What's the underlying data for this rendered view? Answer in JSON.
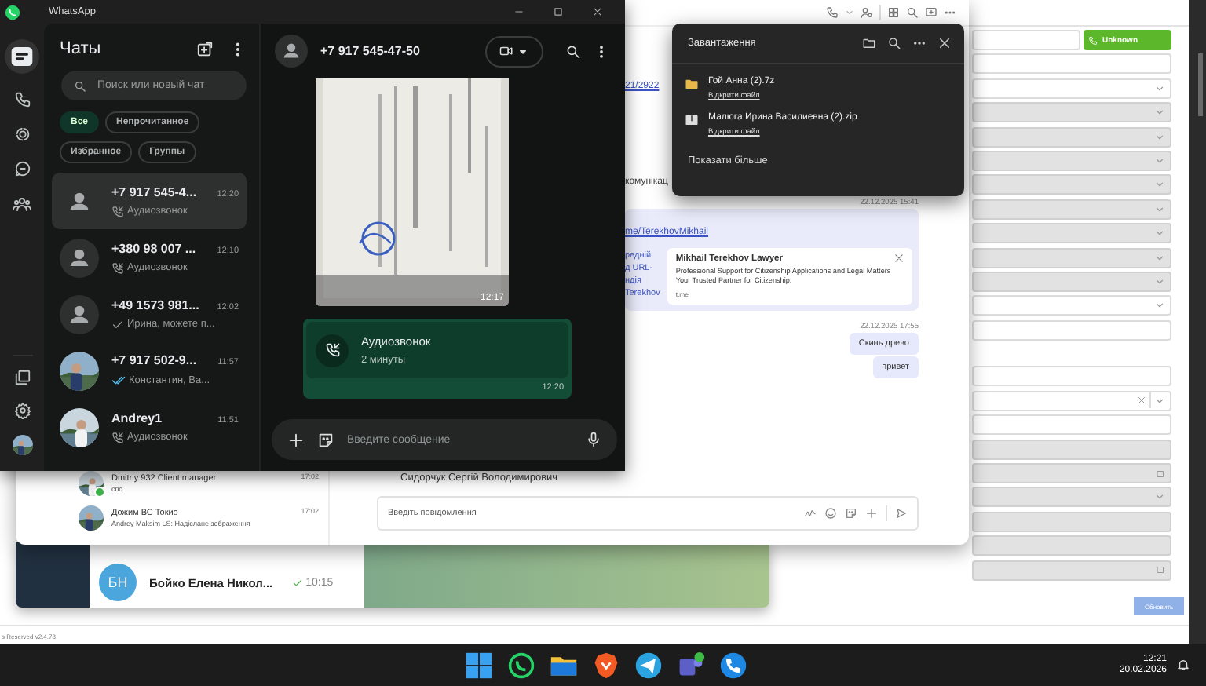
{
  "crm": {
    "call_button": "Unknown",
    "form_fields": [
      {
        "kind": "text",
        "disabled": false
      },
      {
        "kind": "select",
        "disabled": false
      },
      {
        "kind": "select",
        "disabled": true
      },
      {
        "kind": "select",
        "disabled": true
      },
      {
        "kind": "select",
        "disabled": true
      },
      {
        "kind": "select",
        "disabled": true
      },
      {
        "kind": "select",
        "disabled": true
      },
      {
        "kind": "select",
        "disabled": true
      },
      {
        "kind": "select",
        "disabled": true
      },
      {
        "kind": "select",
        "disabled": true
      },
      {
        "kind": "select",
        "disabled": false
      },
      {
        "kind": "text",
        "disabled": false
      }
    ],
    "form_fields_2": [
      {
        "kind": "text",
        "disabled": false
      },
      {
        "kind": "clearable",
        "disabled": false
      },
      {
        "kind": "text",
        "disabled": false
      },
      {
        "kind": "text",
        "disabled": true
      },
      {
        "kind": "date",
        "disabled": true
      },
      {
        "kind": "select",
        "disabled": true
      },
      {
        "kind": "text",
        "disabled": true
      },
      {
        "kind": "text",
        "disabled": true
      },
      {
        "kind": "date",
        "disabled": true
      }
    ],
    "update_button": "Обновить",
    "footer": "s Reserved v2.4.78"
  },
  "telegram": {
    "chat": {
      "initials": "БН",
      "name": "Бойко Елена Никол...",
      "time": "10:15",
      "read": true
    }
  },
  "messenger": {
    "messages": [
      {
        "kind": "link_fragment",
        "text": "21/2922"
      },
      {
        "kind": "text_fragment",
        "text": "комунікац"
      },
      {
        "kind": "date",
        "text": "22.12.2025 15:41"
      },
      {
        "kind": "link_preview",
        "link": "me/TerekhovMikhail",
        "body": [
          "редній",
          "д URL-",
          "ндія",
          "Terekhov"
        ],
        "title": "Mikhail Terekhov Lawyer",
        "description": "Professional Support for Citizenship Applications and Legal Matters Your Trusted Partner for Citizenship.",
        "domain": "t.me"
      },
      {
        "kind": "date",
        "text": "22.12.2025 17:55"
      },
      {
        "kind": "outgoing",
        "text": "Скинь древо"
      },
      {
        "kind": "outgoing",
        "text": "привет"
      }
    ],
    "contact": "Сидорчук Сергій Володимирович",
    "input_placeholder": "Введіть повідомлення",
    "chats": [
      {
        "name": "Dmitriy 932 Client manager",
        "preview": "спс",
        "time": "17:02",
        "online": true
      },
      {
        "name": "Дожим ВС Токио",
        "preview": "Andrey Maksim LS: Надіслане зображення",
        "time": "17:02",
        "online": false
      }
    ]
  },
  "whatsapp": {
    "title": "WhatsApp",
    "heading": "Чаты",
    "search_placeholder": "Поиск или новый чат",
    "filters": [
      {
        "label": "Все",
        "selected": true
      },
      {
        "label": "Непрочитанное",
        "selected": false
      },
      {
        "label": "Избранное",
        "selected": false
      },
      {
        "label": "Группы",
        "selected": false
      }
    ],
    "chats": [
      {
        "name": "+7 917 545-4...",
        "time": "12:20",
        "status_icon": {
          "kind": "call"
        },
        "preview": "Аудиозвонок",
        "avatar": {
          "kind": "default"
        },
        "selected": true
      },
      {
        "name": "+380 98 007 ...",
        "time": "12:10",
        "status_icon": {
          "kind": "call"
        },
        "preview": "Аудиозвонок",
        "avatar": {
          "kind": "default"
        },
        "selected": false
      },
      {
        "name": "+49 1573 981...",
        "time": "12:02",
        "status_icon": {
          "kind": "sent"
        },
        "preview": "Ирина, можете п...",
        "avatar": {
          "kind": "default"
        },
        "selected": false
      },
      {
        "name": "+7 917 502-9...",
        "time": "11:57",
        "status_icon": {
          "kind": "read"
        },
        "preview": "Константин, Ва...",
        "selected": false
      },
      {
        "name": "Andrey1",
        "time": "11:51",
        "status_icon": {
          "kind": "call"
        },
        "preview": "Аудиозвонок",
        "selected": false
      }
    ],
    "conversation": {
      "contact": "+7 917 545-47-50",
      "image_time": "12:17",
      "call": {
        "title": "Аудиозвонок",
        "duration": "2 минуты",
        "time": "12:20"
      },
      "input_placeholder": "Введите сообщение"
    }
  },
  "downloads": {
    "title": "Завантаження",
    "items": [
      {
        "kind": "folder",
        "name": "Гой Анна (2).7z",
        "action": "Відкрити файл"
      },
      {
        "kind": "archive",
        "name": "Малюга Ирина Василиевна (2).zip",
        "action": "Відкрити файл"
      }
    ],
    "more": "Показати більше"
  },
  "taskbar": {
    "time": "12:21",
    "date": "20.02.2026"
  }
}
